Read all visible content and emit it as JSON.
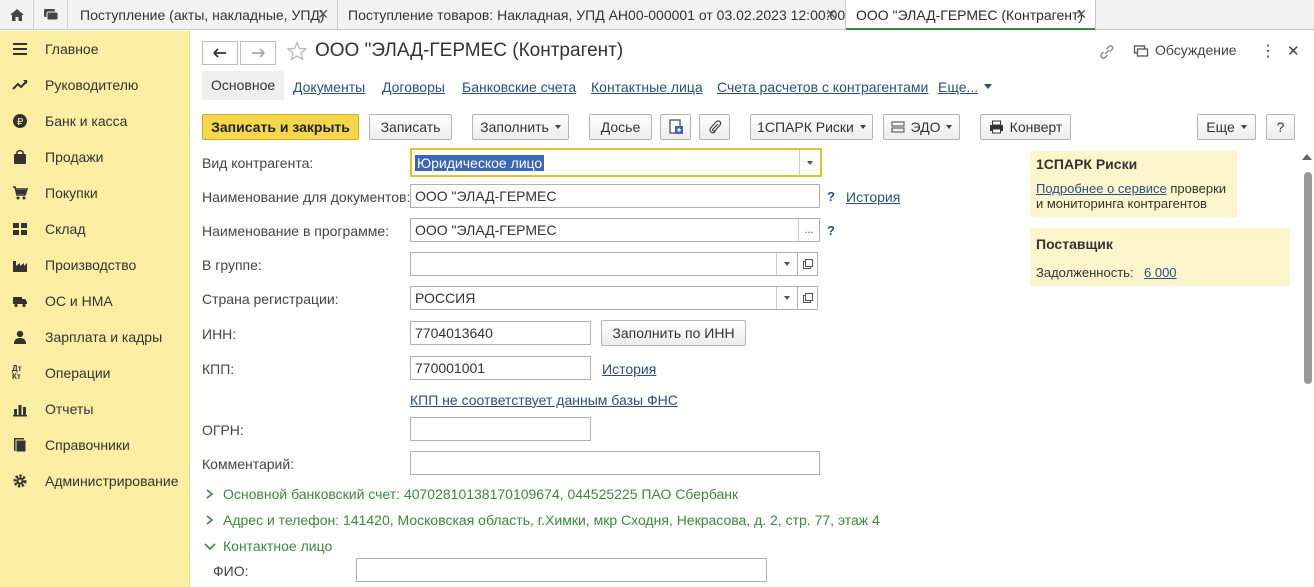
{
  "tabs": [
    {
      "label": "Поступление (акты, накладные, УПД)"
    },
    {
      "label": "Поступление товаров: Накладная, УПД АН00-000001 от 03.02.2023 12:00:00"
    },
    {
      "label": "ООО \"ЭЛАД-ГЕРМЕС (Контрагент)"
    }
  ],
  "sidebar": {
    "items": [
      {
        "label": "Главное",
        "icon": "menu-icon"
      },
      {
        "label": "Руководителю",
        "icon": "trend-icon"
      },
      {
        "label": "Банк и касса",
        "icon": "ruble-icon"
      },
      {
        "label": "Продажи",
        "icon": "bag-icon"
      },
      {
        "label": "Покупки",
        "icon": "cart-icon"
      },
      {
        "label": "Склад",
        "icon": "warehouse-icon"
      },
      {
        "label": "Производство",
        "icon": "factory-icon"
      },
      {
        "label": "ОС и НМА",
        "icon": "truck-icon"
      },
      {
        "label": "Зарплата и кадры",
        "icon": "person-icon"
      },
      {
        "label": "Операции",
        "icon": "dt-kt-icon"
      },
      {
        "label": "Отчеты",
        "icon": "bar-chart-icon"
      },
      {
        "label": "Справочники",
        "icon": "book-icon"
      },
      {
        "label": "Администрирование",
        "icon": "gear-icon"
      }
    ],
    "dt_kt_text": "Дт Кт"
  },
  "header": {
    "title": "ООО \"ЭЛАД-ГЕРМЕС (Контрагент)",
    "discussion": "Обсуждение",
    "more_dots": "⋮",
    "close": "✕"
  },
  "section_tabs": [
    {
      "label": "Основное"
    },
    {
      "label": "Документы"
    },
    {
      "label": "Договоры"
    },
    {
      "label": "Банковские счета"
    },
    {
      "label": "Контактные лица"
    },
    {
      "label": "Счета расчетов с контрагентами"
    },
    {
      "label": "Еще..."
    }
  ],
  "toolbar": {
    "save_close": "Записать и закрыть",
    "save": "Записать",
    "fill": "Заполнить",
    "dossier": "Досье",
    "spark": "1СПАРК Риски",
    "edo": "ЭДО",
    "envelope": "Конверт",
    "more": "Еще",
    "help": "?"
  },
  "form": {
    "kind_label": "Вид контрагента:",
    "kind_value": "Юридическое лицо",
    "docname_label": "Наименование для документов:",
    "docname_value": "ООО \"ЭЛАД-ГЕРМЕС",
    "progname_label": "Наименование в программе:",
    "progname_value": "ООО \"ЭЛАД-ГЕРМЕС",
    "group_label": "В группе:",
    "group_value": "",
    "country_label": "Страна регистрации:",
    "country_value": "РОССИЯ",
    "inn_label": "ИНН:",
    "inn_value": "7704013640",
    "fill_by_inn": "Заполнить по ИНН",
    "kpp_label": "КПП:",
    "kpp_value": "770001001",
    "history": "История",
    "kpp_warning": "КПП не соответствует данным базы ФНС",
    "ogrn_label": "ОГРН:",
    "ogrn_value": "",
    "comment_label": "Комментарий:",
    "comment_value": "",
    "help_mark": "?",
    "ellipsis": "..."
  },
  "groups": {
    "bank": "Основной банковский счет: 40702810138170109674, 044525225 ПАО Сбербанк",
    "address": "Адрес и телефон: 141420, Московская область, г.Химки, мкр Сходня, Некрасова, д. 2, стр. 77, этаж 4",
    "contact": "Контактное лицо",
    "fio_label": "ФИО:",
    "fio_value": ""
  },
  "right_panel": {
    "spark_title": "1СПАРК Риски",
    "spark_link": "Подробнее о сервисе",
    "spark_text1": " проверки",
    "spark_text2": "и мониторинга контрагентов",
    "supplier_title": "Поставщик",
    "debt_label": "Задолженность:",
    "debt_value": "6 000"
  },
  "colors": {
    "sidebar_bg": "#fbeea2",
    "primary_button": "#f6d64a",
    "link": "#2a4f83",
    "group_green": "#3b8a3b",
    "panel_bg": "#fdf6cc"
  }
}
